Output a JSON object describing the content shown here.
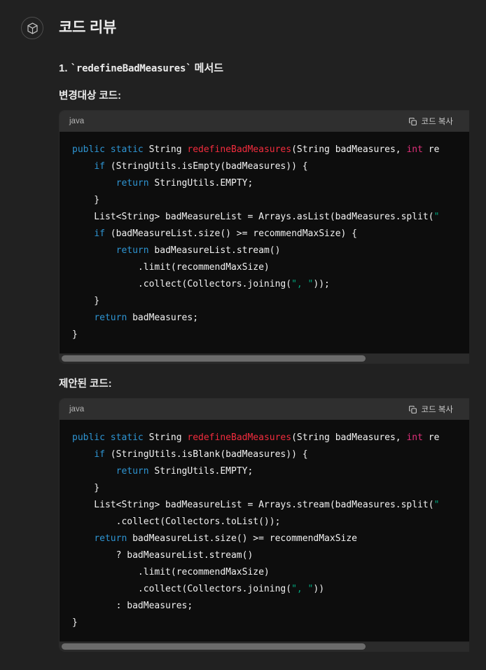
{
  "page": {
    "background": "#212121",
    "accent_blue": "#2e95d3",
    "accent_red": "#f22c3d",
    "accent_pink": "#df3079",
    "accent_green": "#00a67d"
  },
  "header": {
    "avatar_icon": "cube-icon",
    "title": "코드 리뷰"
  },
  "main": {
    "section_number": "1.",
    "section_method": "`redefineBadMeasures`",
    "section_suffix": "메서드",
    "label_before": "변경대상 코드:",
    "label_after": "제안된 코드:"
  },
  "codeblocks": [
    {
      "lang": "java",
      "copy_label": "코드 복사",
      "copy_icon": "copy-icon",
      "scroll_thumb_percent": 75,
      "lines": [
        [
          {
            "t": "public static ",
            "c": "k"
          },
          {
            "t": "String ",
            "c": "ty"
          },
          {
            "t": "redefineBadMeasures",
            "c": "fn"
          },
          {
            "t": "(String badMeasures, ",
            "c": "ty"
          },
          {
            "t": "int ",
            "c": "pr"
          },
          {
            "t": "re",
            "c": "ty"
          }
        ],
        [
          {
            "t": "    ",
            "c": "ty"
          },
          {
            "t": "if ",
            "c": "k"
          },
          {
            "t": "(StringUtils.isEmpty(badMeasures)) {",
            "c": "ty"
          }
        ],
        [
          {
            "t": "        ",
            "c": "ty"
          },
          {
            "t": "return ",
            "c": "k"
          },
          {
            "t": "StringUtils.EMPTY;",
            "c": "ty"
          }
        ],
        [
          {
            "t": "    }",
            "c": "ty"
          }
        ],
        [
          {
            "t": "    List<String> badMeasureList = Arrays.asList(badMeasures.split(",
            "c": "ty"
          },
          {
            "t": "\"",
            "c": "st"
          }
        ],
        [
          {
            "t": "    ",
            "c": "ty"
          },
          {
            "t": "if ",
            "c": "k"
          },
          {
            "t": "(badMeasureList.size() >= recommendMaxSize) {",
            "c": "ty"
          }
        ],
        [
          {
            "t": "        ",
            "c": "ty"
          },
          {
            "t": "return ",
            "c": "k"
          },
          {
            "t": "badMeasureList.stream()",
            "c": "ty"
          }
        ],
        [
          {
            "t": "            .limit(recommendMaxSize)",
            "c": "ty"
          }
        ],
        [
          {
            "t": "            .collect(Collectors.joining(",
            "c": "ty"
          },
          {
            "t": "\", \"",
            "c": "st"
          },
          {
            "t": "));",
            "c": "ty"
          }
        ],
        [
          {
            "t": "    }",
            "c": "ty"
          }
        ],
        [
          {
            "t": "    ",
            "c": "ty"
          },
          {
            "t": "return ",
            "c": "k"
          },
          {
            "t": "badMeasures;",
            "c": "ty"
          }
        ],
        [
          {
            "t": "}",
            "c": "ty"
          }
        ]
      ]
    },
    {
      "lang": "java",
      "copy_label": "코드 복사",
      "copy_icon": "copy-icon",
      "scroll_thumb_percent": 75,
      "lines": [
        [
          {
            "t": "public static ",
            "c": "k"
          },
          {
            "t": "String ",
            "c": "ty"
          },
          {
            "t": "redefineBadMeasures",
            "c": "fn"
          },
          {
            "t": "(String badMeasures, ",
            "c": "ty"
          },
          {
            "t": "int ",
            "c": "pr"
          },
          {
            "t": "re",
            "c": "ty"
          }
        ],
        [
          {
            "t": "    ",
            "c": "ty"
          },
          {
            "t": "if ",
            "c": "k"
          },
          {
            "t": "(StringUtils.isBlank(badMeasures)) {",
            "c": "ty"
          }
        ],
        [
          {
            "t": "        ",
            "c": "ty"
          },
          {
            "t": "return ",
            "c": "k"
          },
          {
            "t": "StringUtils.EMPTY;",
            "c": "ty"
          }
        ],
        [
          {
            "t": "    }",
            "c": "ty"
          }
        ],
        [
          {
            "t": "    List<String> badMeasureList = Arrays.stream(badMeasures.split(",
            "c": "ty"
          },
          {
            "t": "\"",
            "c": "st"
          }
        ],
        [
          {
            "t": "        .collect(Collectors.toList());",
            "c": "ty"
          }
        ],
        [
          {
            "t": "    ",
            "c": "ty"
          },
          {
            "t": "return ",
            "c": "k"
          },
          {
            "t": "badMeasureList.size() >= recommendMaxSize",
            "c": "ty"
          }
        ],
        [
          {
            "t": "        ? badMeasureList.stream()",
            "c": "ty"
          }
        ],
        [
          {
            "t": "            .limit(recommendMaxSize)",
            "c": "ty"
          }
        ],
        [
          {
            "t": "            .collect(Collectors.joining(",
            "c": "ty"
          },
          {
            "t": "\", \"",
            "c": "st"
          },
          {
            "t": "))",
            "c": "ty"
          }
        ],
        [
          {
            "t": "        : badMeasures;",
            "c": "ty"
          }
        ],
        [
          {
            "t": "}",
            "c": "ty"
          }
        ]
      ]
    }
  ]
}
